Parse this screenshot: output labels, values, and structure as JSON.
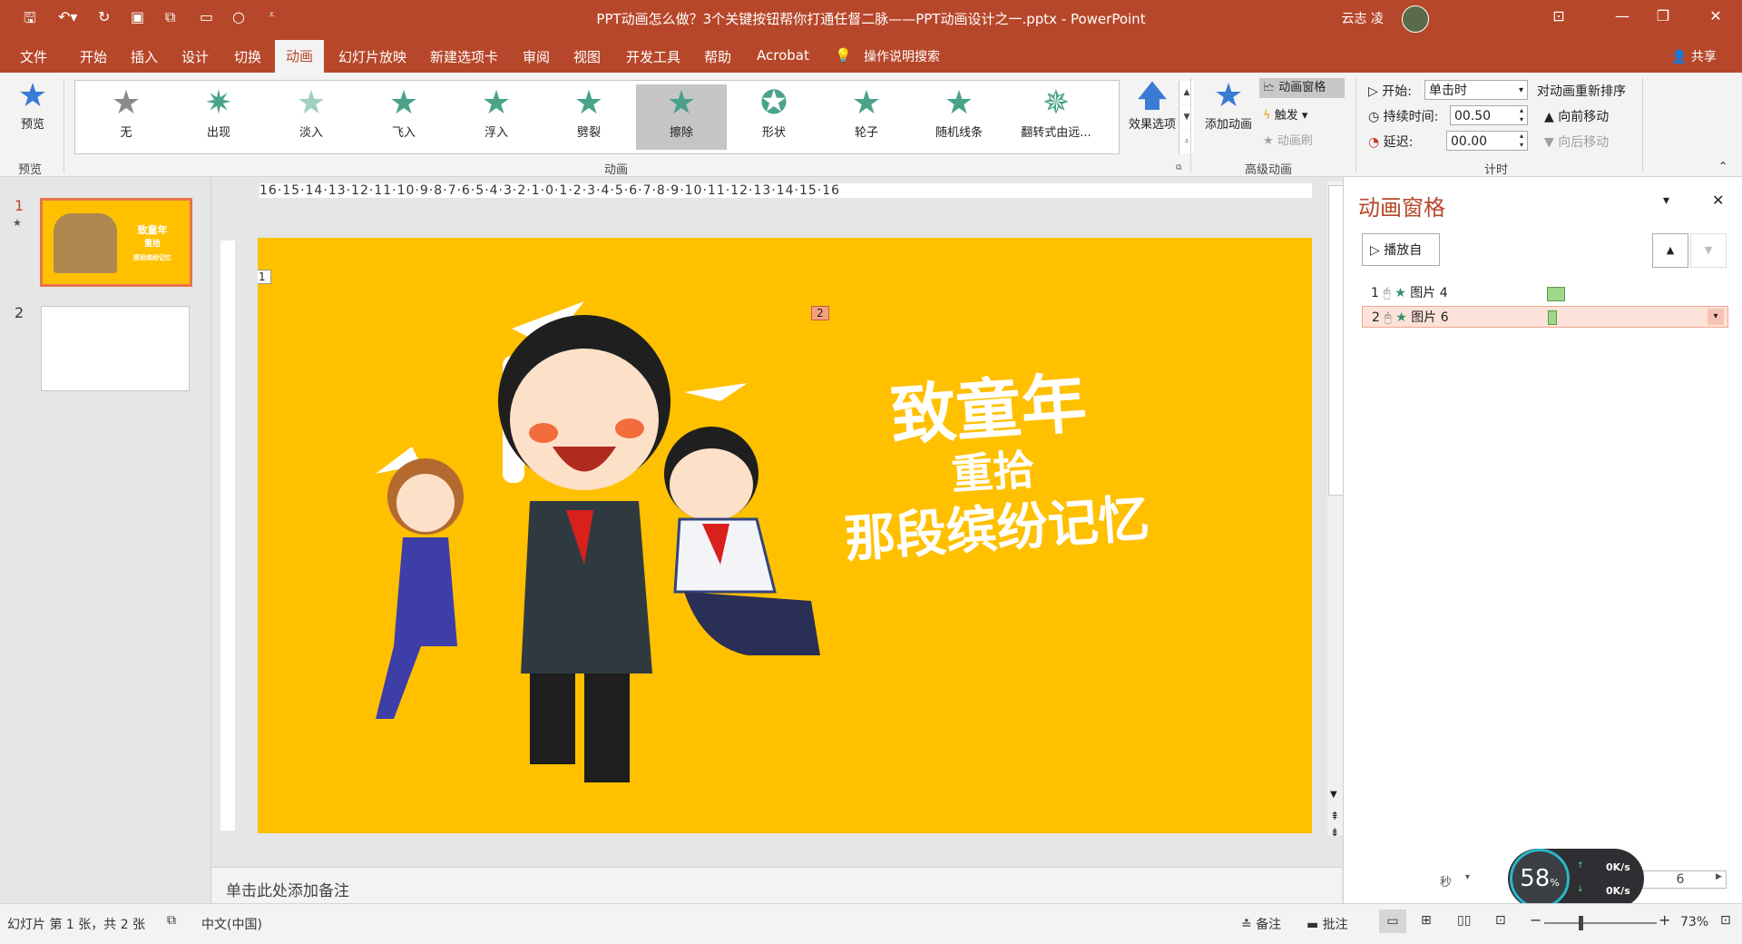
{
  "window": {
    "title": "PPT动画怎么做？3个关键按钮帮你打通任督二脉——PPT动画设计之一.pptx  -  PowerPoint",
    "user": "云志 凌"
  },
  "tabs": [
    "文件",
    "开始",
    "插入",
    "设计",
    "切换",
    "动画",
    "幻灯片放映",
    "新建选项卡",
    "审阅",
    "视图",
    "开发工具",
    "帮助",
    "Acrobat",
    "操作说明搜索"
  ],
  "active_tab": "动画",
  "share_label": "共享",
  "ribbon": {
    "preview_label": "预览",
    "preview_group": "预览",
    "animations": [
      "无",
      "出现",
      "淡入",
      "飞入",
      "浮入",
      "劈裂",
      "擦除",
      "形状",
      "轮子",
      "随机线条",
      "翻转式由远..."
    ],
    "selected_animation": "擦除",
    "effect_options": "效果选项",
    "animation_group": "动画",
    "add_animation": "添加动画",
    "animation_pane": "动画窗格",
    "trigger": "触发",
    "animation_painter": "动画刷",
    "advanced_group": "高级动画",
    "start_label": "开始:",
    "start_value": "单击时",
    "duration_label": "持续时间:",
    "duration_value": "00.50",
    "delay_label": "延迟:",
    "delay_value": "00.00",
    "reorder_label": "对动画重新排序",
    "move_earlier": "向前移动",
    "move_later": "向后移动",
    "timing_group": "计时"
  },
  "ruler": {
    "horizontal": "16·15·14·13·12·11·10·9·8·7·6·5·4·3·2·1·0·1·2·3·4·5·6·7·8·9·10·11·12·13·14·15·16"
  },
  "thumbnails": [
    {
      "number": "1",
      "star": "★"
    },
    {
      "number": "2",
      "star": ""
    }
  ],
  "slide": {
    "tag1": "1",
    "tag2": "2",
    "line1": "致童年",
    "line2": "重拾",
    "line3": "那段缤纷记忆"
  },
  "notes_placeholder": "单击此处添加备注",
  "anim_pane": {
    "title": "动画窗格",
    "play_from": "播放自",
    "items": [
      {
        "index": "1",
        "name": "图片 4"
      },
      {
        "index": "2",
        "name": "图片 6"
      }
    ],
    "timeline_unit": "秒",
    "timeline_num": "6"
  },
  "net_widget": {
    "percent": "58",
    "percent_sign": "%",
    "up": "0K/s",
    "down": "0K/s"
  },
  "status": {
    "slide_info": "幻灯片 第 1 张，共 2 张",
    "language": "中文(中国)",
    "notes": "备注",
    "comments": "批注",
    "zoom": "73%"
  },
  "colors": {
    "accent": "#b7472a",
    "slide_bg": "#ffc000",
    "selected_row": "#fde2d9",
    "bar_green": "#9fd68a"
  }
}
